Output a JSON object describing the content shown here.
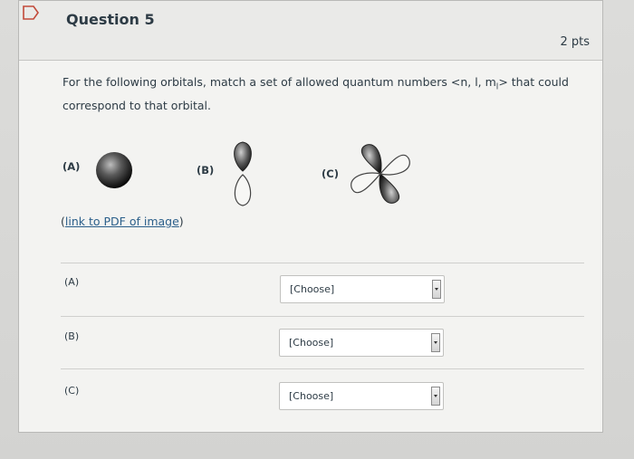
{
  "question": {
    "title": "Question 5",
    "points": "2 pts",
    "prompt_line1": "For the following orbitals, match a set of allowed quantum numbers <n, l, m",
    "prompt_sub": "l",
    "prompt_line1_end": "> that could",
    "prompt_line2": "correspond to that orbital."
  },
  "orbitals": [
    {
      "label": "(A)",
      "shape": "s-orbital-sphere"
    },
    {
      "label": "(B)",
      "shape": "p-orbital-dumbbell"
    },
    {
      "label": "(C)",
      "shape": "d-orbital-cloverleaf"
    }
  ],
  "link": {
    "text": "link to PDF of image",
    "open_paren": "(",
    "close_paren": ")"
  },
  "matches": [
    {
      "label": "(A)",
      "selected": "[Choose]"
    },
    {
      "label": "(B)",
      "selected": "[Choose]"
    },
    {
      "label": "(C)",
      "selected": "[Choose]"
    }
  ],
  "icons": {
    "flag": "flag-icon",
    "dropdown": "dropdown-arrow-icon"
  },
  "colors": {
    "title": "#2d3b45",
    "link": "#2b5f8a",
    "flag": "#c24a3a"
  }
}
